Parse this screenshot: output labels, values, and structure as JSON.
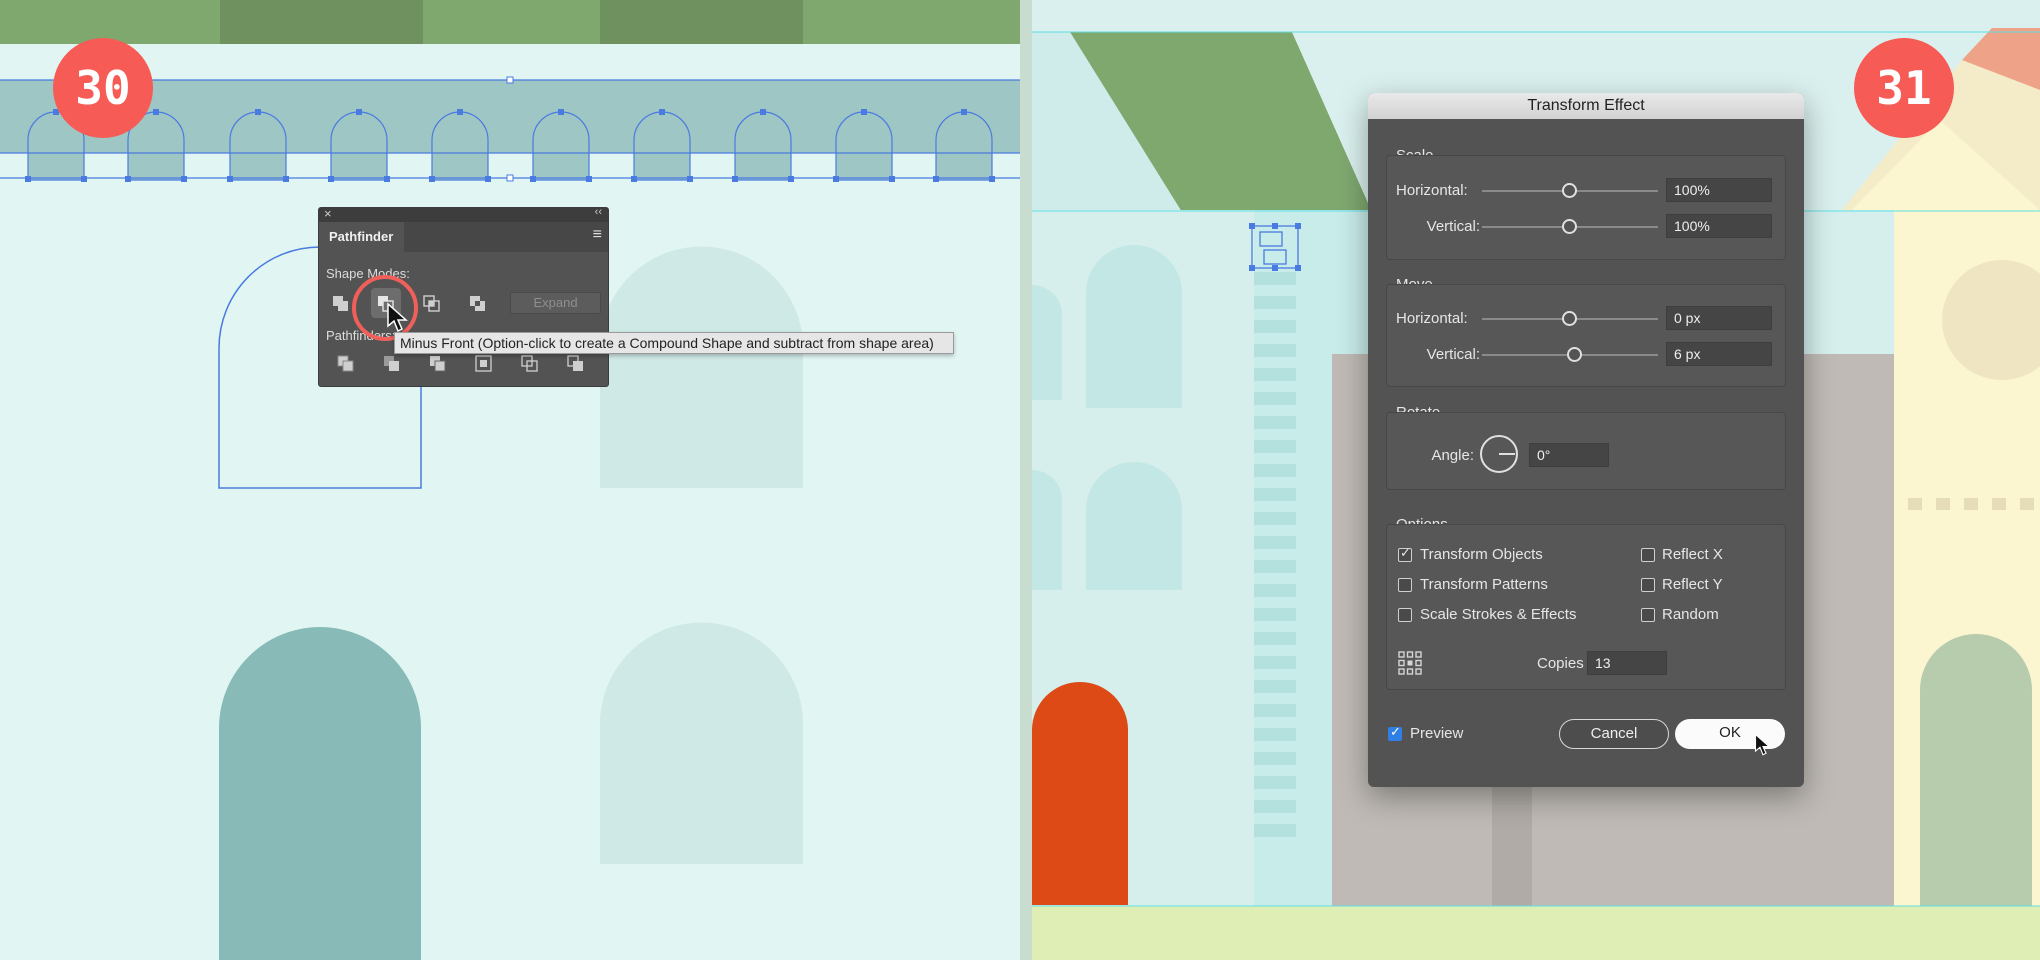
{
  "left_step": {
    "number": "30"
  },
  "right_step": {
    "number": "31"
  },
  "pathfinder": {
    "tab_title": "Pathfinder",
    "shape_modes_label": "Shape Modes:",
    "pathfinders_label": "Pathfinders:",
    "expand_label": "Expand",
    "close_icon": "×",
    "collapse_icon": "‹‹",
    "menu_icon": "≡",
    "tooltip": "Minus Front (Option-click to create a Compound Shape and subtract from shape area)",
    "shape_mode_icons": [
      "unite-icon",
      "minus-front-icon",
      "intersect-icon",
      "exclude-icon"
    ],
    "pathfinder_icons": [
      "divide-icon",
      "trim-icon",
      "merge-icon",
      "crop-icon",
      "outline-icon",
      "minus-back-icon"
    ]
  },
  "dialog": {
    "title": "Transform Effect",
    "scale": {
      "label": "Scale",
      "horizontal_label": "Horizontal:",
      "horizontal_value": "100%",
      "vertical_label": "Vertical:",
      "vertical_value": "100%"
    },
    "move": {
      "label": "Move",
      "horizontal_label": "Horizontal:",
      "horizontal_value": "0 px",
      "vertical_label": "Vertical:",
      "vertical_value": "6 px"
    },
    "rotate": {
      "label": "Rotate",
      "angle_label": "Angle:",
      "angle_value": "0°"
    },
    "options": {
      "label": "Options",
      "transform_objects": "Transform Objects",
      "transform_patterns": "Transform Patterns",
      "scale_strokes": "Scale Strokes & Effects",
      "reflect_x": "Reflect X",
      "reflect_y": "Reflect Y",
      "random": "Random",
      "copies_label": "Copies",
      "copies_value": "13"
    },
    "preview_label": "Preview",
    "cancel_label": "Cancel",
    "ok_label": "OK"
  },
  "colors": {
    "step_badge": "#f65c55",
    "selection_blue": "#4a7be0",
    "roof_green": "#7fa86f",
    "door_orange": "#dd4a16"
  }
}
